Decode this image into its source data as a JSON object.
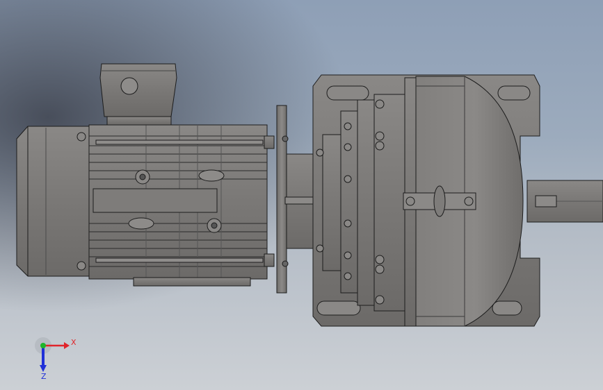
{
  "viewport": {
    "background_top": "#8e9fb6",
    "background_bottom": "#ccd0d5",
    "model_color": "#7d7b7a"
  },
  "triad": {
    "x_label": "X",
    "z_label": "Z",
    "x_color": "#e0242a",
    "y_color": "#1fb52b",
    "z_color": "#2030d8"
  }
}
